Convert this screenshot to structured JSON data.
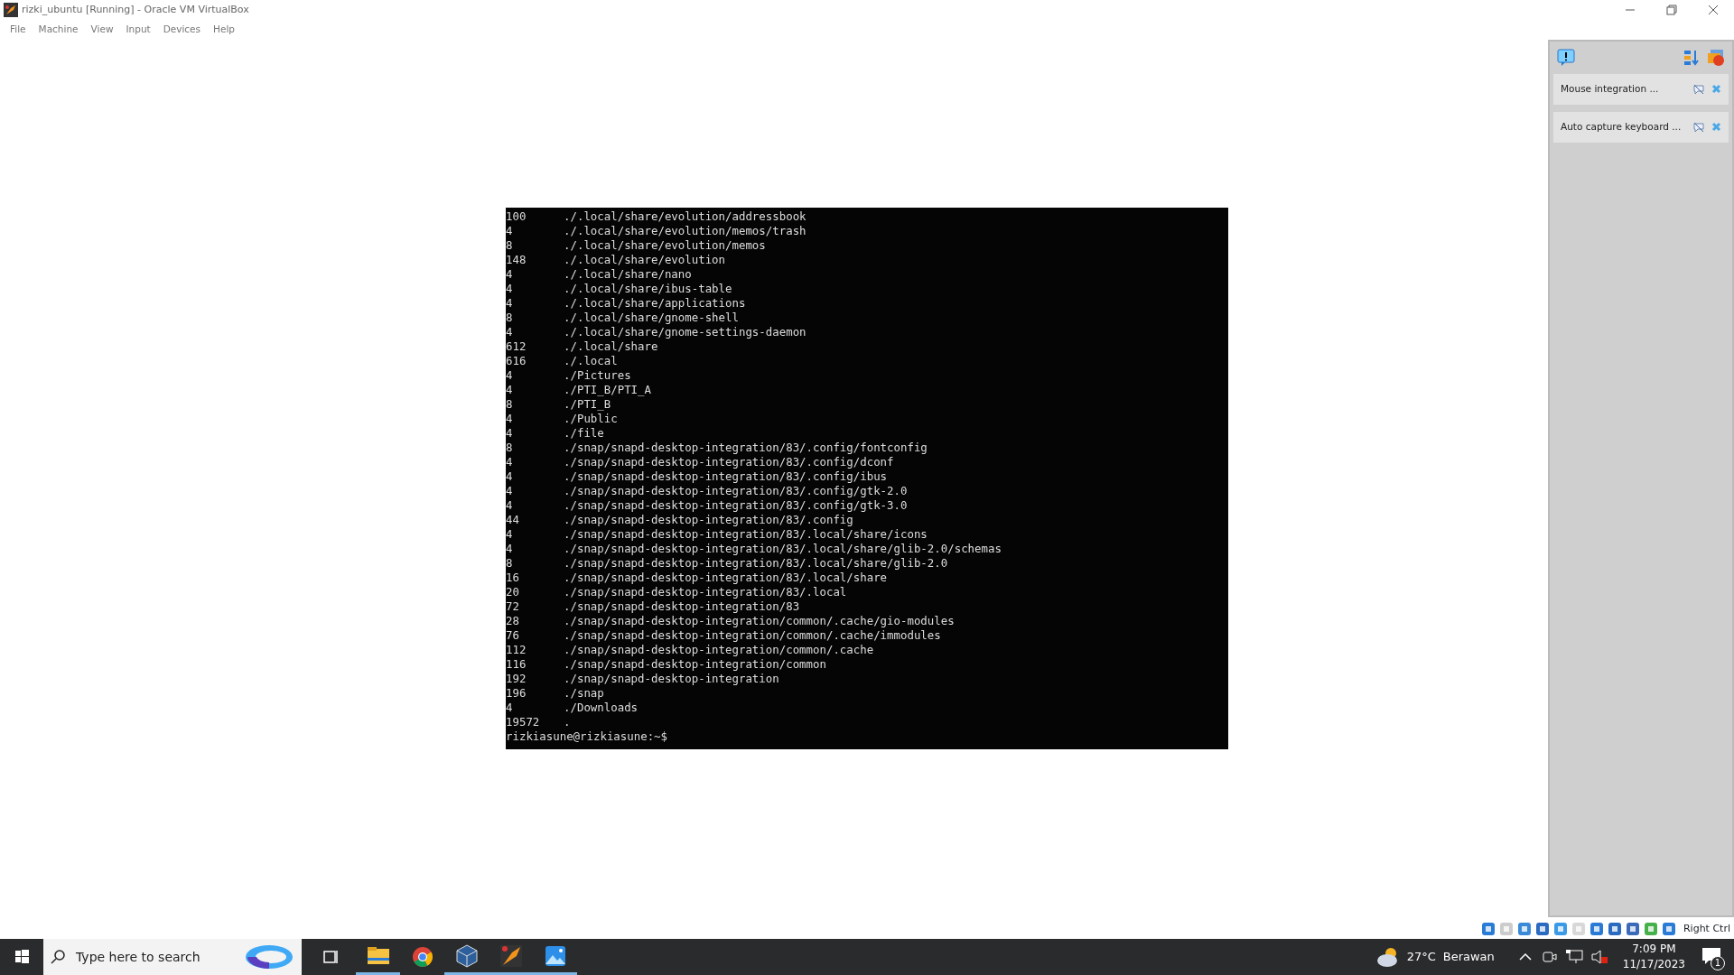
{
  "window": {
    "title": "rizki_ubuntu [Running] - Oracle VM VirtualBox"
  },
  "menu": [
    "File",
    "Machine",
    "View",
    "Input",
    "Devices",
    "Help"
  ],
  "terminal": {
    "lines": [
      {
        "size": "100",
        "path": "./.local/share/evolution/addressbook"
      },
      {
        "size": "4",
        "path": "./.local/share/evolution/memos/trash"
      },
      {
        "size": "8",
        "path": "./.local/share/evolution/memos"
      },
      {
        "size": "148",
        "path": "./.local/share/evolution"
      },
      {
        "size": "4",
        "path": "./.local/share/nano"
      },
      {
        "size": "4",
        "path": "./.local/share/ibus-table"
      },
      {
        "size": "4",
        "path": "./.local/share/applications"
      },
      {
        "size": "8",
        "path": "./.local/share/gnome-shell"
      },
      {
        "size": "4",
        "path": "./.local/share/gnome-settings-daemon"
      },
      {
        "size": "612",
        "path": "./.local/share"
      },
      {
        "size": "616",
        "path": "./.local"
      },
      {
        "size": "4",
        "path": "./Pictures"
      },
      {
        "size": "4",
        "path": "./PTI_B/PTI_A"
      },
      {
        "size": "8",
        "path": "./PTI_B"
      },
      {
        "size": "4",
        "path": "./Public"
      },
      {
        "size": "4",
        "path": "./file"
      },
      {
        "size": "8",
        "path": "./snap/snapd-desktop-integration/83/.config/fontconfig"
      },
      {
        "size": "4",
        "path": "./snap/snapd-desktop-integration/83/.config/dconf"
      },
      {
        "size": "4",
        "path": "./snap/snapd-desktop-integration/83/.config/ibus"
      },
      {
        "size": "4",
        "path": "./snap/snapd-desktop-integration/83/.config/gtk-2.0"
      },
      {
        "size": "4",
        "path": "./snap/snapd-desktop-integration/83/.config/gtk-3.0"
      },
      {
        "size": "44",
        "path": "./snap/snapd-desktop-integration/83/.config"
      },
      {
        "size": "4",
        "path": "./snap/snapd-desktop-integration/83/.local/share/icons"
      },
      {
        "size": "4",
        "path": "./snap/snapd-desktop-integration/83/.local/share/glib-2.0/schemas"
      },
      {
        "size": "8",
        "path": "./snap/snapd-desktop-integration/83/.local/share/glib-2.0"
      },
      {
        "size": "16",
        "path": "./snap/snapd-desktop-integration/83/.local/share"
      },
      {
        "size": "20",
        "path": "./snap/snapd-desktop-integration/83/.local"
      },
      {
        "size": "72",
        "path": "./snap/snapd-desktop-integration/83"
      },
      {
        "size": "28",
        "path": "./snap/snapd-desktop-integration/common/.cache/gio-modules"
      },
      {
        "size": "76",
        "path": "./snap/snapd-desktop-integration/common/.cache/immodules"
      },
      {
        "size": "112",
        "path": "./snap/snapd-desktop-integration/common/.cache"
      },
      {
        "size": "116",
        "path": "./snap/snapd-desktop-integration/common"
      },
      {
        "size": "192",
        "path": "./snap/snapd-desktop-integration"
      },
      {
        "size": "196",
        "path": "./snap"
      },
      {
        "size": "4",
        "path": "./Downloads"
      },
      {
        "size": "19572",
        "path": "."
      }
    ],
    "prompt": "rizkiasune@rizkiasune:~$"
  },
  "notifications": [
    "Mouse integration ...",
    "Auto capture keyboard ..."
  ],
  "status_bar": {
    "host_key": "Right Ctrl"
  },
  "taskbar": {
    "search": {
      "placeholder": "Type here to search"
    },
    "apps": [
      {
        "kind": "explorer",
        "running": true
      },
      {
        "kind": "chrome",
        "running": false
      },
      {
        "kind": "vbox",
        "running": true
      },
      {
        "kind": "vm",
        "running": true
      },
      {
        "kind": "photos",
        "running": true
      }
    ],
    "weather": {
      "temperature": "27°C",
      "condition": "Berawan"
    },
    "time": "7:09 PM",
    "date": "11/17/2023",
    "notification_count": "1"
  }
}
